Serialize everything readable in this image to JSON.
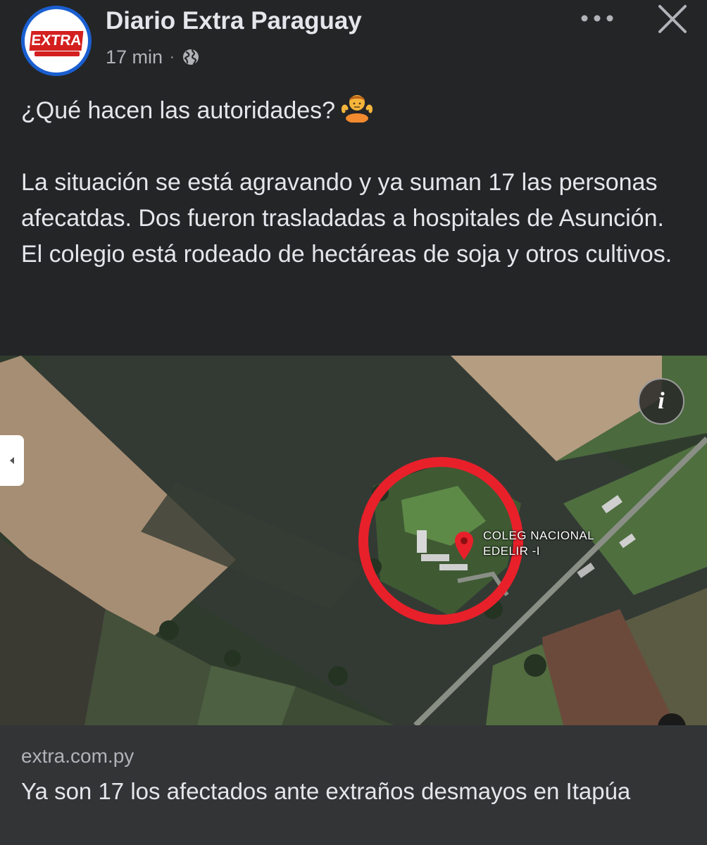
{
  "header": {
    "page_name": "Diario Extra Paraguay",
    "timestamp": "17 min",
    "separator": "·",
    "audience_icon": "globe-icon",
    "more_icon": "more-dots-icon",
    "close_icon": "close-icon",
    "avatar": {
      "logo_text": "EXTRA",
      "brand_color": "#d3201f",
      "ring_color": "#1a5fd0"
    }
  },
  "post": {
    "line1": "¿Qué hacen las autoridades?",
    "emoji": "person-shrugging-emoji",
    "paragraph1": "La situación se está agravando y ya suman 17 las personas afecatdas. Dos fueron trasladadas a hospitales de Asunción.",
    "paragraph2": "El colegio está rodeado de hectáreas de soja y otros cultivos."
  },
  "map": {
    "label": "COLEG NACIONAL\nEDELIR -I",
    "info_icon": "info-icon",
    "info_glyph": "i",
    "marker_icon": "map-pin-icon",
    "highlight_color": "#e8202a"
  },
  "link_preview": {
    "domain": "extra.com.py",
    "title": "Ya son 17 los afectados ante extraños desmayos en Itapúa"
  },
  "colors": {
    "background": "#242527",
    "text_primary": "#e4e6eb",
    "text_secondary": "#b0b3b8",
    "link_background": "#323436"
  }
}
